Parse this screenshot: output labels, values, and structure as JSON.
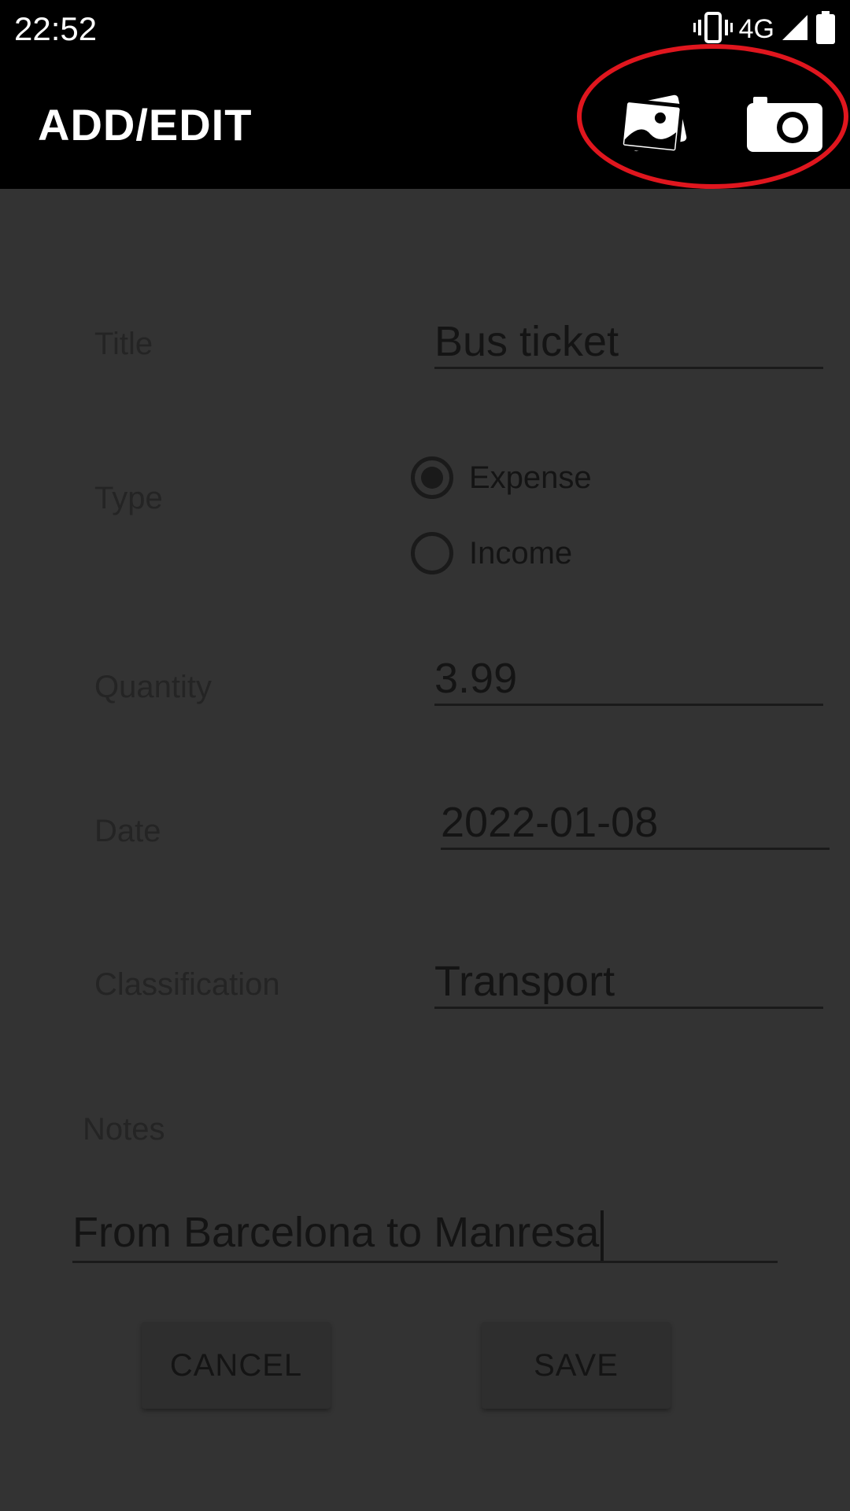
{
  "status_bar": {
    "time": "22:52",
    "network": "4G",
    "icons": [
      "vibrate-icon",
      "signal-icon",
      "battery-icon"
    ]
  },
  "app_bar": {
    "title": "ADD/EDIT",
    "actions": [
      {
        "name": "gallery-icon",
        "label": "Gallery"
      },
      {
        "name": "camera-icon",
        "label": "Camera"
      }
    ],
    "highlight_color": "#e0161e"
  },
  "form": {
    "title": {
      "label": "Title",
      "value": "Bus ticket"
    },
    "type": {
      "label": "Type",
      "options": [
        {
          "label": "Expense",
          "checked": true
        },
        {
          "label": "Income",
          "checked": false
        }
      ]
    },
    "quantity": {
      "label": "Quantity",
      "value": "3.99"
    },
    "date": {
      "label": "Date",
      "value": "2022-01-08"
    },
    "classification": {
      "label": "Classification",
      "value": "Transport"
    },
    "notes": {
      "label": "Notes",
      "value": "From Barcelona to Manresa"
    }
  },
  "buttons": {
    "cancel": "CANCEL",
    "save": "SAVE"
  },
  "colors": {
    "background": "#333333",
    "app_bar": "#000000",
    "text_dark": "#141414"
  }
}
